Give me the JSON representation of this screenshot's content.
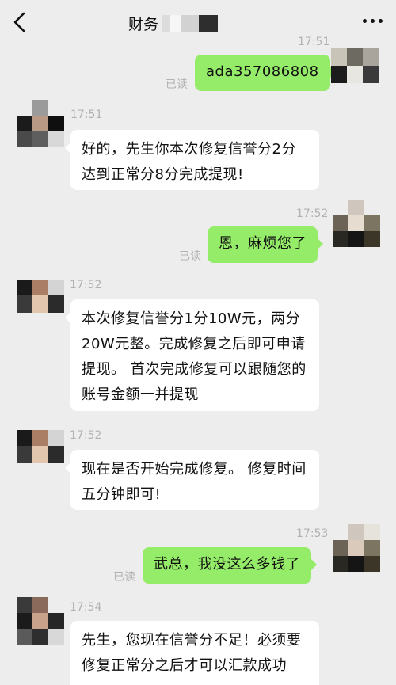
{
  "header": {
    "title": "财务",
    "back_icon": "chevron-left-icon",
    "more_icon": "more-dots-icon"
  },
  "colors": {
    "background": "#ededed",
    "sent_bubble": "#95ec69",
    "received_bubble": "#ffffff",
    "meta_text": "#b2b2b2"
  },
  "messages": [
    {
      "direction": "sent",
      "time": "17:51",
      "read": "已读",
      "text": "ada357086808"
    },
    {
      "direction": "received",
      "time": "17:51",
      "text": "好的，先生你本次修复信誉分2分达到正常分8分完成提现!"
    },
    {
      "direction": "sent",
      "time": "17:52",
      "read": "已读",
      "text": "恩，麻烦您了"
    },
    {
      "direction": "received",
      "time": "17:52",
      "text": "本次修复信誉分1分10W元，两分20W元整。完成修复之后即可申请提现。 首次完成修复可以跟随您的账号金额一并提现"
    },
    {
      "direction": "received",
      "time": "17:52",
      "text": " 现在是否开始完成修复。 修复时间五分钟即可!"
    },
    {
      "direction": "sent",
      "time": "17:53",
      "read": "已读",
      "text": "武总，我没这么多钱了"
    },
    {
      "direction": "received",
      "time": "17:54",
      "text": " 先生，您现在信誉分不足！必须要修复正常分之后才可以汇款成功"
    }
  ]
}
